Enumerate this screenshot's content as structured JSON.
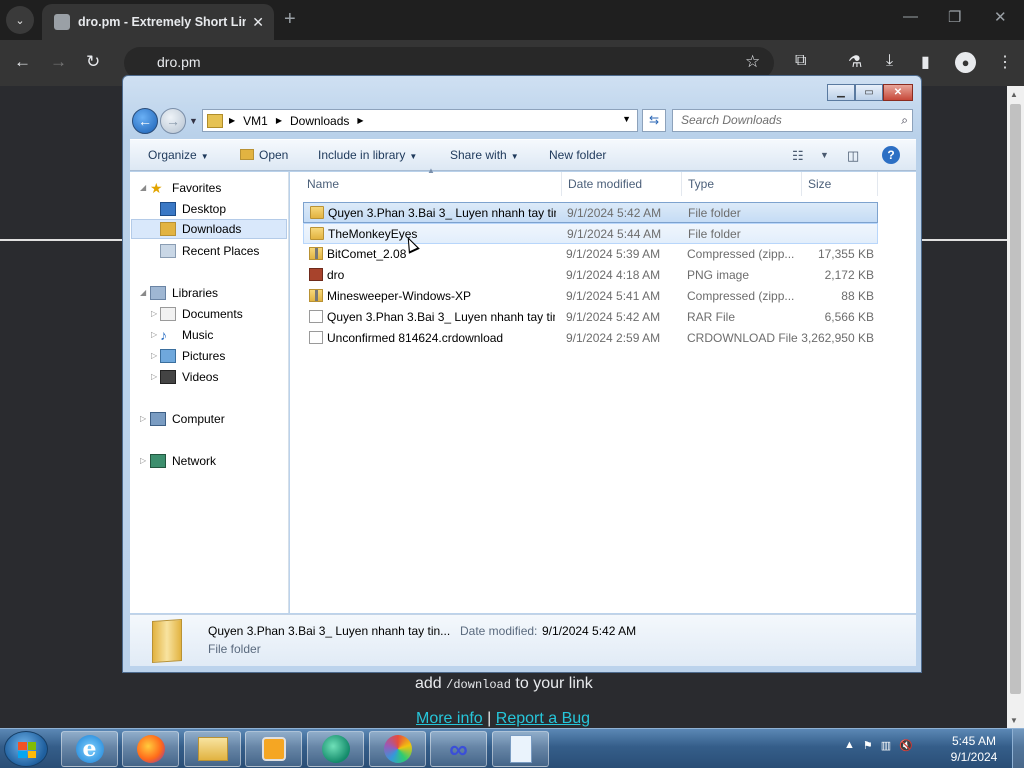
{
  "browser": {
    "tab_title": "dro.pm - Extremely Short Links",
    "tab_close": "✕",
    "new_tab": "+",
    "url": "dro.pm",
    "nav": {
      "back": "←",
      "forward": "→",
      "reload": "↻"
    },
    "window_controls": {
      "minimize": "—",
      "maximize": "❐",
      "close": "✕"
    }
  },
  "page": {
    "hint_before": "add ",
    "hint_code": "/download",
    "hint_after": " to your link",
    "more_info": "More info",
    "separator": "|",
    "report_bug": "Report a Bug"
  },
  "explorer": {
    "breadcrumb": [
      "VM1",
      "Downloads"
    ],
    "search_placeholder": "Search Downloads",
    "commands": {
      "organize": "Organize",
      "open": "Open",
      "include_in_library": "Include in library",
      "share_with": "Share with",
      "new_folder": "New folder"
    },
    "nav": {
      "favorites": "Favorites",
      "desktop": "Desktop",
      "downloads": "Downloads",
      "recent_places": "Recent Places",
      "libraries": "Libraries",
      "documents": "Documents",
      "music": "Music",
      "pictures": "Pictures",
      "videos": "Videos",
      "computer": "Computer",
      "network": "Network"
    },
    "columns": [
      "Name",
      "Date modified",
      "Type",
      "Size"
    ],
    "files": [
      {
        "name": "Quyen 3.Phan 3.Bai 3_ Luyen nhanh tay tin...",
        "date": "9/1/2024 5:42 AM",
        "type": "File folder",
        "size": "",
        "icon": "folder"
      },
      {
        "name": "TheMonkeyEyes",
        "date": "9/1/2024 5:44 AM",
        "type": "File folder",
        "size": "",
        "icon": "folder"
      },
      {
        "name": "BitComet_2.08",
        "date": "9/1/2024 5:39 AM",
        "type": "Compressed (zipp...",
        "size": "17,355 KB",
        "icon": "zip"
      },
      {
        "name": "dro",
        "date": "9/1/2024 4:18 AM",
        "type": "PNG image",
        "size": "2,172 KB",
        "icon": "png"
      },
      {
        "name": "Minesweeper-Windows-XP",
        "date": "9/1/2024 5:41 AM",
        "type": "Compressed (zipp...",
        "size": "88 KB",
        "icon": "zip"
      },
      {
        "name": "Quyen 3.Phan 3.Bai 3_ Luyen nhanh tay tin...",
        "date": "9/1/2024 5:42 AM",
        "type": "RAR File",
        "size": "6,566 KB",
        "icon": "doc"
      },
      {
        "name": "Unconfirmed 814624.crdownload",
        "date": "9/1/2024 2:59 AM",
        "type": "CRDOWNLOAD File",
        "size": "3,262,950 KB",
        "icon": "doc"
      }
    ],
    "details": {
      "name": "Quyen 3.Phan 3.Bai 3_ Luyen nhanh tay tin...",
      "date_label": "Date modified:",
      "date_value": "9/1/2024 5:42 AM",
      "type": "File folder"
    }
  },
  "taskbar": {
    "apps": [
      "internet-explorer",
      "firefox",
      "file-explorer",
      "media-player",
      "app-green",
      "paint",
      "app-infinity",
      "notepad"
    ],
    "time": "5:45 AM",
    "date": "9/1/2024"
  }
}
